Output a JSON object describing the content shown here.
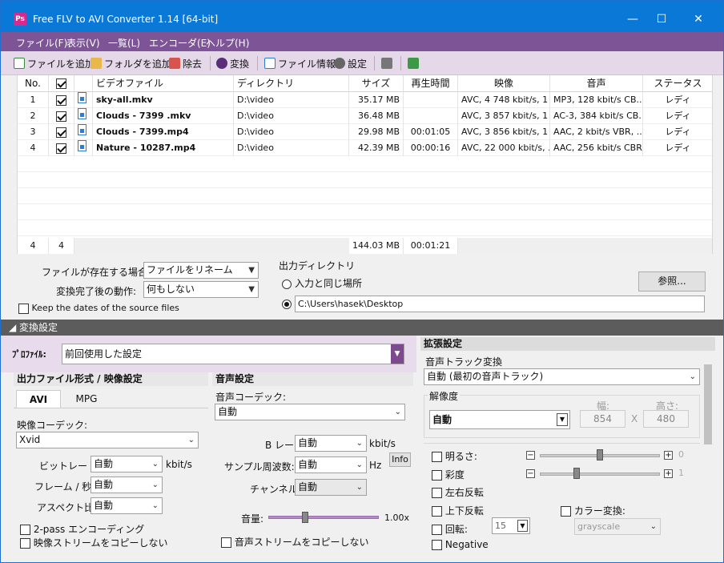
{
  "window": {
    "title": "Free FLV to AVI Converter 1.14  [64-bit]",
    "icon_text": "Ps",
    "minimize_glyph": "—",
    "maximize_glyph": "☐",
    "close_glyph": "✕"
  },
  "menu": [
    "ファイル(F)",
    "表示(V)",
    "一覧(L)",
    "エンコーダ(E)",
    "ヘルプ(H)"
  ],
  "toolbar": {
    "add_file": "ファイルを追加",
    "add_folder": "フォルダを追加",
    "remove": "除去",
    "convert": "変換",
    "file_info": "ファイル情報",
    "settings": "設定"
  },
  "table": {
    "headers": [
      "No.",
      "",
      "ビデオファイル",
      "ディレクトリ",
      "サイズ",
      "再生時間",
      "映像",
      "音声",
      "ステータス"
    ],
    "rows": [
      {
        "no": "1",
        "checked": true,
        "name": "sky-all.mkv",
        "dir": "D:\\video",
        "size": "35.17 MB",
        "duration": "",
        "video": "AVC, 4 748 kbit/s, 1 ...",
        "audio": "MP3, 128 kbit/s CB...",
        "status": "レディ"
      },
      {
        "no": "2",
        "checked": true,
        "name": "Clouds - 7399 .mkv",
        "dir": "D:\\video",
        "size": "36.48 MB",
        "duration": "",
        "video": "AVC, 3 857 kbit/s, 1 ...",
        "audio": "AC-3, 384 kbit/s CB...",
        "status": "レディ"
      },
      {
        "no": "3",
        "checked": true,
        "name": "Clouds - 7399.mp4",
        "dir": "D:\\video",
        "size": "29.98 MB",
        "duration": "00:01:05",
        "video": "AVC, 3 856 kbit/s, 1 ...",
        "audio": "AAC, 2 kbit/s VBR, ...",
        "status": "レディ"
      },
      {
        "no": "4",
        "checked": true,
        "name": "Nature - 10287.mp4",
        "dir": "D:\\video",
        "size": "42.39 MB",
        "duration": "00:00:16",
        "video": "AVC, 22 000 kbit/s, ...",
        "audio": "AAC, 256 kbit/s CBR...",
        "status": "レディ"
      }
    ],
    "footer": {
      "count": "4",
      "checked_count": "4",
      "total_size": "144.03 MB",
      "total_duration": "00:01:21"
    }
  },
  "options": {
    "if_exists_label": "ファイルが存在する場合:",
    "if_exists_value": "ファイルをリネーム",
    "after_convert_label": "変換完了後の動作:",
    "after_convert_value": "何もしない",
    "keep_dates_label": "Keep the dates of the source files"
  },
  "output": {
    "label": "出力ディレクトリ",
    "same_as_input": "入力と同じ場所",
    "browse": "参照...",
    "path": "C:\\Users\\hasek\\Desktop"
  },
  "conversion": {
    "section_title": "◢ 変換設定",
    "profile_label": "ﾌﾟﾛﾌｧｲﾙ:",
    "profile_value": "前回使用した設定"
  },
  "video": {
    "group_title": "出力ファイル形式 / 映像設定",
    "tabs": [
      "AVI",
      "MPG"
    ],
    "codec_label": "映像コーデック:",
    "codec_value": "Xvid",
    "bitrate_label": "ビットレート:",
    "bitrate_value": "自動",
    "bitrate_unit": "kbit/s",
    "fps_label": "フレーム / 秒:",
    "fps_value": "自動",
    "aspect_label": "アスペクト比:",
    "aspect_value": "自動",
    "two_pass": "2-pass エンコーディング",
    "copy_video": "映像ストリームをコピーしない"
  },
  "audio": {
    "group_title": "音声設定",
    "codec_label": "音声コーデック:",
    "codec_value": "自動",
    "bitrate_label": "B レート:",
    "bitrate_value": "自動",
    "bitrate_unit": "kbit/s",
    "samplerate_label": "サンプル周波数:",
    "samplerate_value": "自動",
    "samplerate_unit": "Hz",
    "info_button": "Info",
    "channels_label": "チャンネル:",
    "channels_value": "自動",
    "volume_label": "音量:",
    "volume_value": "1.00x",
    "copy_audio": "音声ストリームをコピーしない"
  },
  "advanced": {
    "group_title": "拡張設定",
    "audio_track_label": "音声トラック変換",
    "audio_track_value": "自動 (最初の音声トラック)",
    "resolution_label": "解像度",
    "resolution_value": "自動",
    "width_label": "幅:",
    "width_value": "854",
    "height_label": "高さ:",
    "height_value": "480",
    "x_sep": "X",
    "brightness": "明るさ:",
    "brightness_value": "0",
    "saturation": "彩度",
    "saturation_value": "1",
    "hflip": "左右反転",
    "vflip": "上下反転",
    "color_convert": "カラー変換:",
    "color_value": "grayscale",
    "rotate": "回転:",
    "rotate_value": "15",
    "negative": "Negative"
  }
}
